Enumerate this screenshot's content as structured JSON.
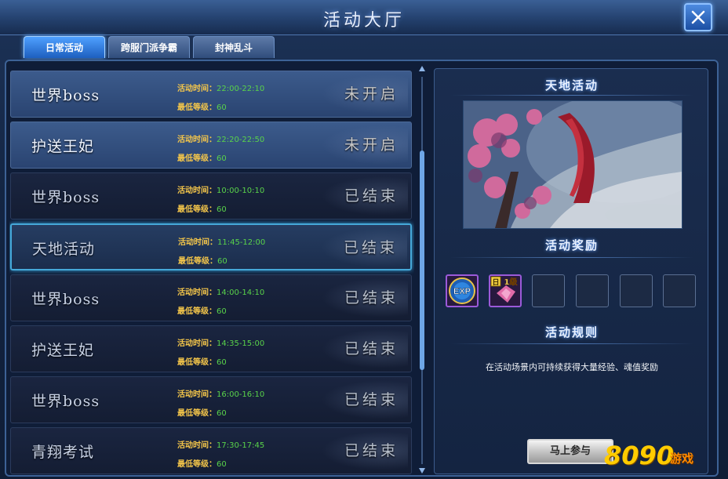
{
  "window": {
    "title": "活动大厅"
  },
  "tabs": [
    {
      "label": "日常活动",
      "active": true
    },
    {
      "label": "跨服门派争霸",
      "active": false
    },
    {
      "label": "封神乱斗",
      "active": false
    }
  ],
  "labels": {
    "time": "活动时间：",
    "level": "最低等级："
  },
  "activities": [
    {
      "name": "世界boss",
      "time": "22:00-22:10",
      "level": "60",
      "status": "未开启",
      "state": "open"
    },
    {
      "name": "护送王妃",
      "time": "22:20-22:50",
      "level": "60",
      "status": "未开启",
      "state": "open"
    },
    {
      "name": "世界boss",
      "time": "10:00-10:10",
      "level": "60",
      "status": "已结束",
      "state": "ended"
    },
    {
      "name": "天地活动",
      "time": "11:45-12:00",
      "level": "60",
      "status": "已结束",
      "state": "selected"
    },
    {
      "name": "世界boss",
      "time": "14:00-14:10",
      "level": "60",
      "status": "已结束",
      "state": "ended"
    },
    {
      "name": "护送王妃",
      "time": "14:35-15:00",
      "level": "60",
      "status": "已结束",
      "state": "ended"
    },
    {
      "name": "世界boss",
      "time": "16:00-16:10",
      "level": "60",
      "status": "已结束",
      "state": "ended"
    },
    {
      "name": "青翔考试",
      "time": "17:30-17:45",
      "level": "60",
      "status": "已结束",
      "state": "ended"
    }
  ],
  "detail": {
    "title": "天地活动",
    "rewards_title": "活动奖励",
    "rewards": [
      {
        "icon": "exp-icon",
        "text": "EXP"
      },
      {
        "icon": "gem-icon",
        "text": "日",
        "badge": "1级"
      }
    ],
    "empty_slots": 4,
    "rules_title": "活动规则",
    "rules_text": "在活动场景内可持续获得大量经验、魂值奖励",
    "join_label": "马上参与"
  },
  "watermark": {
    "number": "8090",
    "text": "游戏"
  },
  "colors": {
    "label": "#f4c64a",
    "value": "#59d34a",
    "selected_border": "#45a8d8",
    "tab_active": "#1d5fbf"
  }
}
